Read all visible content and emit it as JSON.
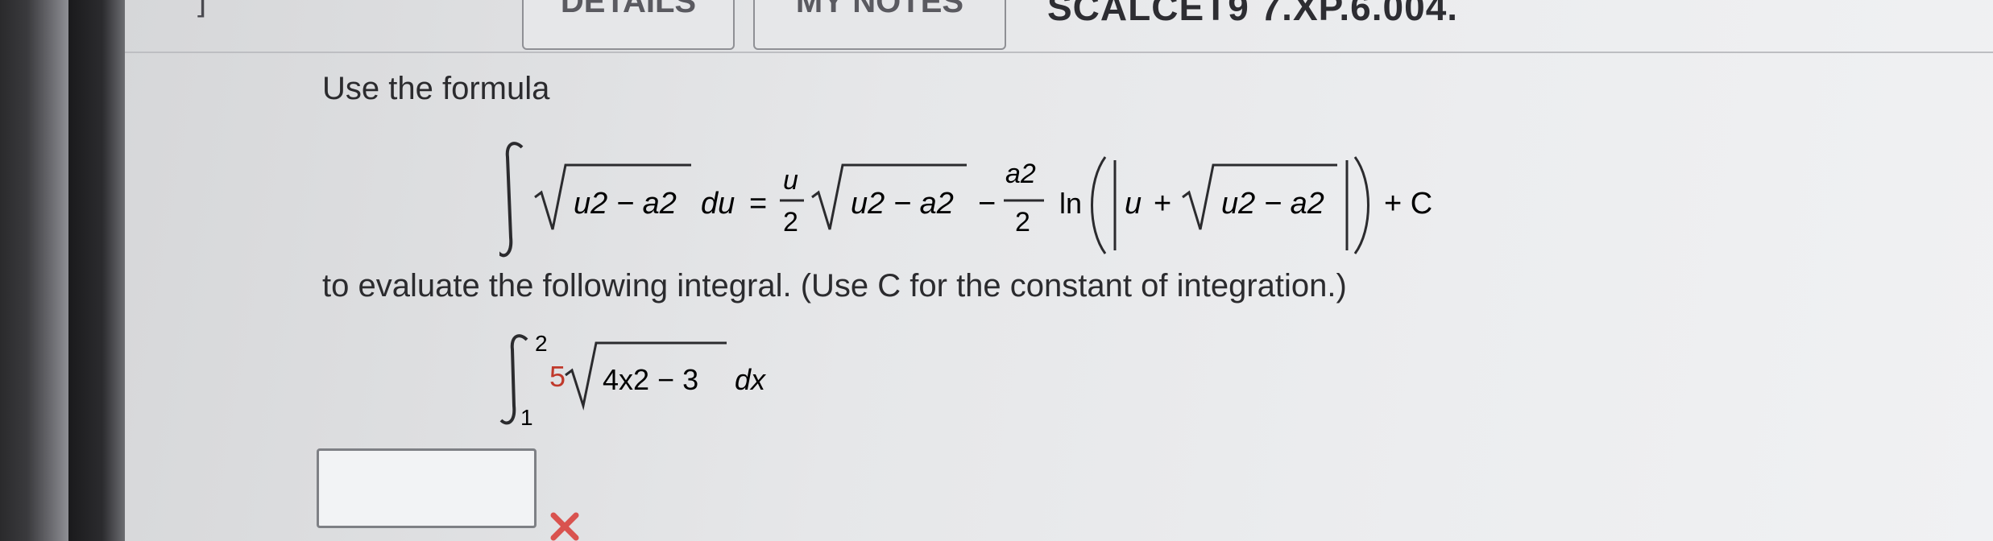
{
  "header": {
    "left_text": "]",
    "tab_details": "DETAILS",
    "tab_notes": "MY NOTES",
    "problem_code": "SCALCET9 7.XP.6.004."
  },
  "question": {
    "intro": "Use the formula",
    "instruction": "to evaluate the following integral. (Use C for the constant of integration.)",
    "formula": {
      "integrand": "u2 − a2",
      "du": "du",
      "equals": "=",
      "frac1_num": "u",
      "frac1_den": "2",
      "sqrt_term": "u2 − a2",
      "minus": "−",
      "frac2_num": "a2",
      "frac2_den": "2",
      "ln": "ln",
      "plus_c": "+ C"
    },
    "integral": {
      "upper": "2",
      "lower": "1",
      "coefficient": "5",
      "radicand": "4x2 − 3",
      "dx": "dx"
    }
  },
  "answer": {
    "value": "",
    "status_icon": "x-mark-icon",
    "status_color": "#d9534f"
  }
}
